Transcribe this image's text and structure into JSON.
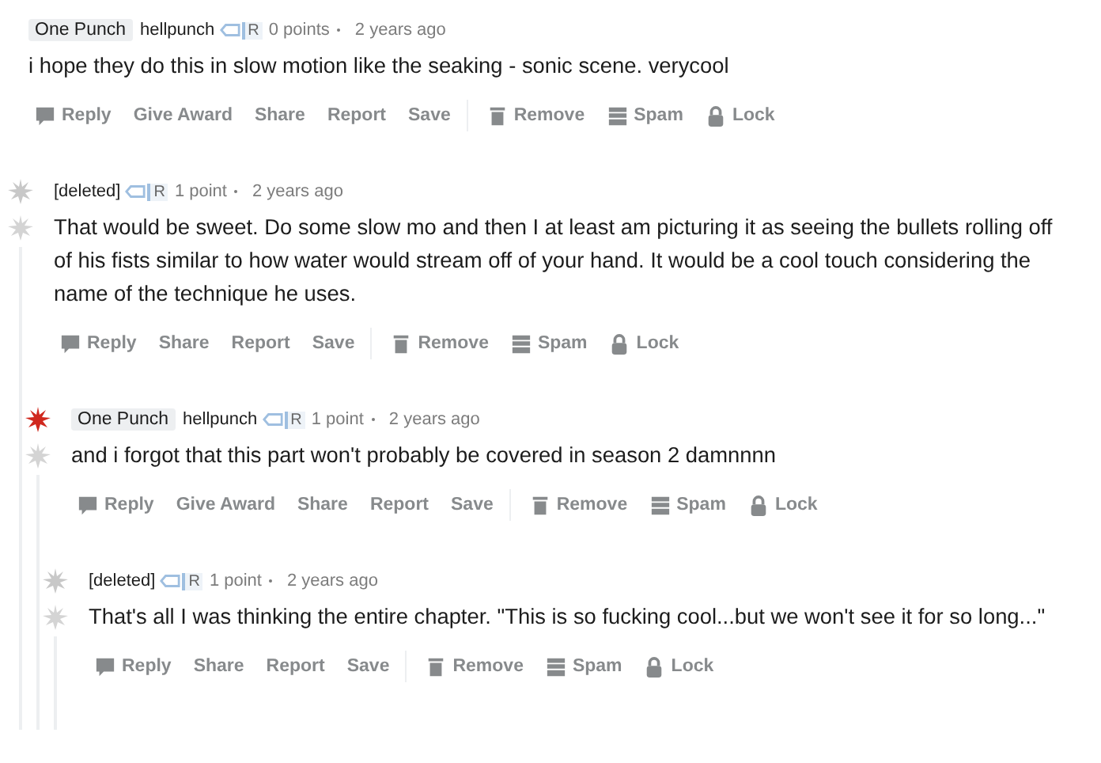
{
  "comments": [
    {
      "flair": "One Punch",
      "author": "hellpunch",
      "badge": "R",
      "points": "0 points",
      "age": "2 years ago",
      "body": "i hope they do this in slow motion like the seaking - sonic scene. verycool",
      "actions": [
        {
          "label": "Reply",
          "kind": "reply"
        },
        {
          "label": "Give Award",
          "kind": "plain"
        },
        {
          "label": "Share",
          "kind": "plain"
        },
        {
          "label": "Report",
          "kind": "plain"
        },
        {
          "label": "Save",
          "kind": "plain"
        },
        {
          "label": "Remove",
          "kind": "remove"
        },
        {
          "label": "Spam",
          "kind": "spam"
        },
        {
          "label": "Lock",
          "kind": "lock"
        }
      ]
    },
    {
      "color": "#c8c8c8",
      "author": "[deleted]",
      "badge": "R",
      "points": "1 point",
      "age": "2 years ago",
      "body": "That would be sweet. Do some slow mo and then I at least am picturing it as seeing the bullets rolling off of his fists similar to how water would stream off of your hand. It would be a cool touch considering the name of the technique he uses.",
      "actions": [
        {
          "label": "Reply",
          "kind": "reply"
        },
        {
          "label": "Share",
          "kind": "plain"
        },
        {
          "label": "Report",
          "kind": "plain"
        },
        {
          "label": "Save",
          "kind": "plain"
        },
        {
          "label": "Remove",
          "kind": "remove"
        },
        {
          "label": "Spam",
          "kind": "spam"
        },
        {
          "label": "Lock",
          "kind": "lock"
        }
      ],
      "children": [
        {
          "color": "#d0281e",
          "flair": "One Punch",
          "author": "hellpunch",
          "badge": "R",
          "points": "1 point",
          "age": "2 years ago",
          "body": "and i forgot that this part won't probably be covered in season 2 damnnnn",
          "actions": [
            {
              "label": "Reply",
              "kind": "reply"
            },
            {
              "label": "Give Award",
              "kind": "plain"
            },
            {
              "label": "Share",
              "kind": "plain"
            },
            {
              "label": "Report",
              "kind": "plain"
            },
            {
              "label": "Save",
              "kind": "plain"
            },
            {
              "label": "Remove",
              "kind": "remove"
            },
            {
              "label": "Spam",
              "kind": "spam"
            },
            {
              "label": "Lock",
              "kind": "lock"
            }
          ],
          "children": [
            {
              "color": "#c8c8c8",
              "author": "[deleted]",
              "badge": "R",
              "points": "1 point",
              "age": "2 years ago",
              "body": "That's all I was thinking the entire chapter. \"This is so fucking cool...but we won't see it for so long...\"",
              "actions": [
                {
                  "label": "Reply",
                  "kind": "reply"
                },
                {
                  "label": "Share",
                  "kind": "plain"
                },
                {
                  "label": "Report",
                  "kind": "plain"
                },
                {
                  "label": "Save",
                  "kind": "plain"
                },
                {
                  "label": "Remove",
                  "kind": "remove"
                },
                {
                  "label": "Spam",
                  "kind": "spam"
                },
                {
                  "label": "Lock",
                  "kind": "lock"
                }
              ]
            }
          ]
        }
      ]
    }
  ]
}
